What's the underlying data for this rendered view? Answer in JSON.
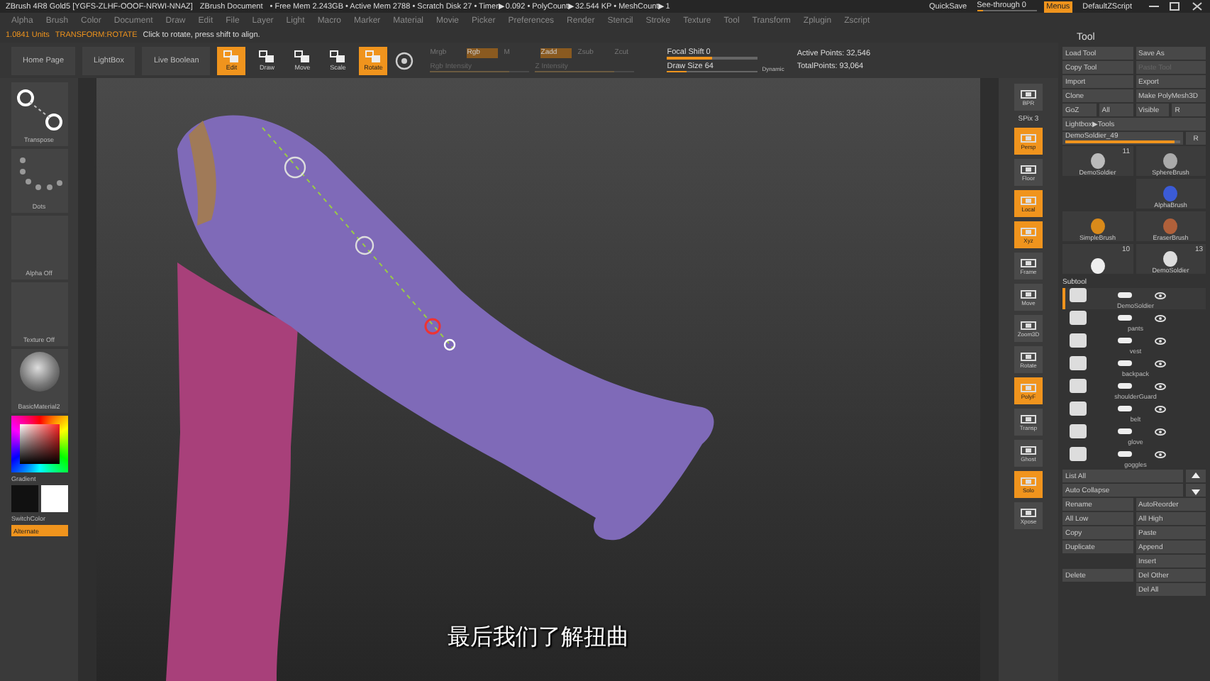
{
  "title_bar": {
    "app": "ZBrush 4R8 Gold5 [YGFS-ZLHF-OOOF-NRWI-NNAZ]",
    "document": "ZBrush Document",
    "stats": "• Free Mem 2.243GB • Active Mem 2788 • Scratch Disk 27 • Timer▶0.092 • PolyCount▶32.544 KP • MeshCount▶1",
    "quicksave": "QuickSave",
    "see_through": {
      "label": "See-through 0",
      "level": 0.1
    },
    "menus": {
      "label": "Menus",
      "on": true
    },
    "script": "DefaultZScript"
  },
  "menu_bar": [
    "Alpha",
    "Brush",
    "Color",
    "Document",
    "Draw",
    "Edit",
    "File",
    "Layer",
    "Light",
    "Macro",
    "Marker",
    "Material",
    "Movie",
    "Picker",
    "Preferences",
    "Render",
    "Stencil",
    "Stroke",
    "Texture",
    "Tool",
    "Transform",
    "Zplugin",
    "Zscript"
  ],
  "info_bar": {
    "units": "1.0841 Units",
    "mode": "TRANSFORM:ROTATE",
    "hint": "Click to rotate, press shift to align."
  },
  "toolbar": {
    "buttons": [
      "Home Page",
      "LightBox",
      "Live Boolean"
    ],
    "modes": [
      {
        "label": "Edit",
        "selected": true
      },
      {
        "label": "Draw",
        "selected": false
      },
      {
        "label": "Move",
        "selected": false
      },
      {
        "label": "Scale",
        "selected": false
      },
      {
        "label": "Rotate",
        "selected": true
      }
    ],
    "channels": [
      {
        "label": "Mrgb",
        "on": false
      },
      {
        "label": "Rgb",
        "on": true
      },
      {
        "label": "M",
        "on": false
      },
      {
        "label": "Zadd",
        "on": true
      },
      {
        "label": "Zsub",
        "on": false
      },
      {
        "label": "Zcut",
        "on": false
      }
    ],
    "rgb_intensity": {
      "label": "Rgb Intensity",
      "level": 0.8
    },
    "z_intensity": {
      "label": "Z Intensity",
      "level": 0.8
    },
    "focal_shift": {
      "label": "Focal Shift 0",
      "level": 0.5
    },
    "draw_size": {
      "label": "Draw Size 64",
      "level": 0.22
    },
    "dynamic": "Dynamic",
    "active_points": "Active Points: 32,546",
    "total_points": "TotalPoints: 93,064"
  },
  "left_shelf": {
    "items": [
      {
        "kind": "transpose",
        "label": "Transpose"
      },
      {
        "kind": "dots",
        "label": "Dots"
      },
      {
        "kind": "blank",
        "label": "Alpha Off"
      },
      {
        "kind": "blank",
        "label": "Texture Off"
      },
      {
        "kind": "material",
        "label": "BasicMaterial2"
      }
    ],
    "gradient": "Gradient",
    "switch_color": "SwitchColor",
    "alternate": "Alternate"
  },
  "right_shelf": [
    {
      "kind": "button",
      "label": "BPR",
      "selected": false
    },
    {
      "kind": "text",
      "label": "SPix 3",
      "selected": false
    },
    {
      "kind": "button",
      "label": "Persp",
      "selected": true
    },
    {
      "kind": "button",
      "label": "Floor",
      "selected": false
    },
    {
      "kind": "button",
      "label": "Local",
      "selected": true
    },
    {
      "kind": "button",
      "label": "Xyz",
      "selected": true
    },
    {
      "kind": "button",
      "label": "Frame",
      "selected": false
    },
    {
      "kind": "button",
      "label": "Move",
      "selected": false
    },
    {
      "kind": "button",
      "label": "Zoom3D",
      "selected": false
    },
    {
      "kind": "button",
      "label": "Rotate",
      "selected": false
    },
    {
      "kind": "button",
      "label": "PolyF",
      "selected": true
    },
    {
      "kind": "button",
      "label": "Transp",
      "selected": false
    },
    {
      "kind": "button",
      "label": "Ghost",
      "selected": false
    },
    {
      "kind": "button",
      "label": "Solo",
      "selected": true
    },
    {
      "kind": "button",
      "label": "Xpose",
      "selected": false
    }
  ],
  "tool_panel": {
    "title": "Tool",
    "rows": [
      [
        {
          "label": "Load Tool",
          "disabled": false
        },
        {
          "label": "Save As",
          "disabled": false
        }
      ],
      [
        {
          "label": "Copy Tool",
          "disabled": false
        },
        {
          "label": "Paste Tool",
          "disabled": true
        }
      ],
      [
        {
          "label": "Import",
          "disabled": false
        },
        {
          "label": "Export",
          "disabled": false
        }
      ],
      [
        {
          "label": "Clone",
          "disabled": false
        },
        {
          "label": "Make PolyMesh3D",
          "disabled": false
        }
      ],
      [
        {
          "label": "GoZ",
          "disabled": false
        },
        {
          "label": "All",
          "disabled": false
        },
        {
          "label": "Visible",
          "disabled": false
        },
        {
          "label": "R",
          "disabled": false
        }
      ]
    ],
    "lightbox": "Lightbox▶Tools",
    "current_tool": {
      "label": "DemoSoldier_49",
      "level": 0.95
    },
    "slider_r": "R",
    "tools": [
      {
        "name": "DemoSoldier",
        "count": "11"
      },
      {
        "name": "SphereBrush"
      },
      {
        "name": "AlphaBrush"
      },
      {
        "name": "SimpleBrush"
      },
      {
        "name": "EraserBrush"
      },
      {
        "count": "10"
      },
      {
        "name": "DemoSoldier",
        "count": "13"
      }
    ],
    "subtool_title": "Subtool",
    "subtools": [
      {
        "name": "DemoSoldier",
        "selected": true
      },
      {
        "name": "pants",
        "selected": false
      },
      {
        "name": "vest",
        "selected": false
      },
      {
        "name": "backpack",
        "selected": false
      },
      {
        "name": "shoulderGuard",
        "selected": false
      },
      {
        "name": "belt",
        "selected": false
      },
      {
        "name": "glove",
        "selected": false
      },
      {
        "name": "goggles",
        "selected": false
      }
    ],
    "list_all": "List All",
    "auto_collapse": "Auto Collapse",
    "actions": [
      {
        "left": "Rename",
        "right": "AutoReorder"
      },
      {
        "left": "All Low",
        "right": "All High"
      },
      {
        "left": "Copy",
        "right": "Paste"
      },
      {
        "left": "Duplicate",
        "right": "Append"
      },
      {
        "right": "Insert"
      },
      {
        "left": "Delete",
        "right": "Del Other"
      },
      {
        "right": "Del All"
      }
    ]
  },
  "subtitle": "最后我们了解扭曲"
}
